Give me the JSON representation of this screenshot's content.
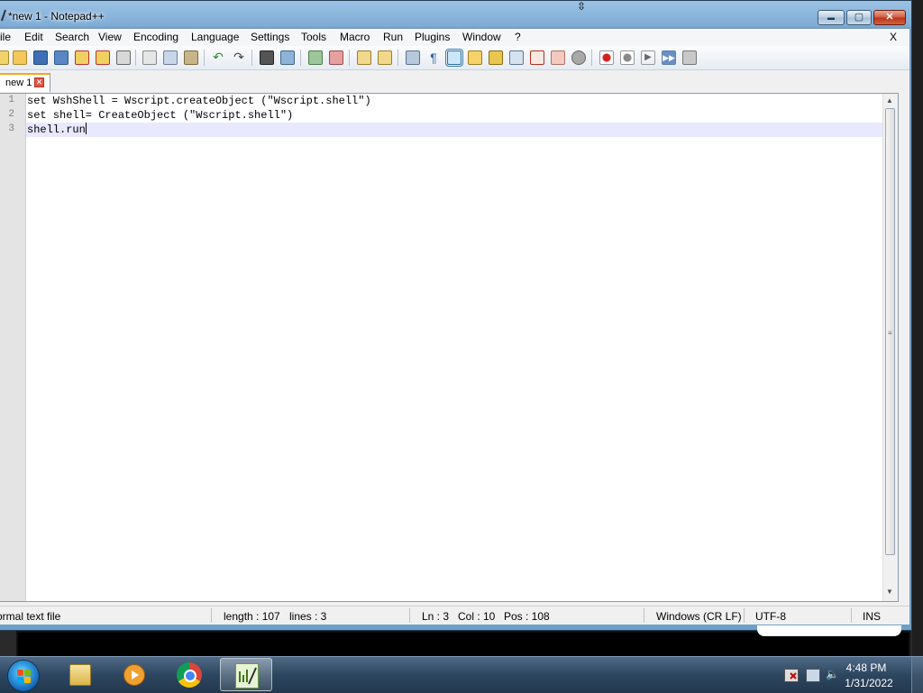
{
  "window": {
    "title": "*new 1 - Notepad++",
    "caption_buttons": {
      "minimize": "▬",
      "maximize": "▢",
      "close": "✕"
    }
  },
  "menu": {
    "items": [
      "ile",
      "Edit",
      "Search",
      "View",
      "Encoding",
      "Language",
      "Settings",
      "Tools",
      "Macro",
      "Run",
      "Plugins",
      "Window",
      "?"
    ],
    "close_document": "X"
  },
  "toolbar": {
    "icons": [
      "new-file-icon",
      "open-file-icon",
      "save-icon",
      "save-all-icon",
      "close-icon",
      "close-all-icon",
      "print-icon",
      "cut-icon",
      "copy-icon",
      "paste-icon",
      "undo-icon",
      "redo-icon",
      "find-icon",
      "replace-icon",
      "zoom-in-icon",
      "zoom-out-icon",
      "sync-vertical-icon",
      "sync-horizontal-icon",
      "word-wrap-icon",
      "show-all-characters-icon",
      "indent-guide-icon",
      "user-defined-language-icon",
      "document-map-icon",
      "function-list-icon",
      "folder-as-workspace-icon",
      "monitoring-icon",
      "record-macro-icon",
      "stop-recording-icon",
      "playback-macro-icon",
      "run-macro-multiple-icon",
      "save-macro-icon"
    ]
  },
  "tabs": [
    {
      "label": "new 1",
      "close": "✕"
    }
  ],
  "editor": {
    "line_numbers": [
      "1",
      "2",
      "3"
    ],
    "lines": [
      "set WshShell = Wscript.createObject (\"Wscript.shell\")",
      "set shell= CreateObject (\"Wscript.shell\")",
      "shell.run"
    ],
    "current_line_index": 2
  },
  "scrollbar": {
    "up": "▲",
    "down": "▼",
    "grip": "≡"
  },
  "statusbar": {
    "file_type": "ormal text file",
    "length": "length : 107",
    "lines": "lines : 3",
    "ln": "Ln : 3",
    "col": "Col : 10",
    "pos": "Pos : 108",
    "eol": "Windows (CR LF)",
    "encoding": "UTF-8",
    "mode": "INS"
  },
  "taskbar": {
    "pinned": [
      "windows-explorer-icon",
      "media-player-icon",
      "chrome-icon",
      "notepad-plus-plus-icon"
    ],
    "active_app": "notepad-plus-plus-icon",
    "clock_time": "4:48 PM",
    "clock_date": "1/31/2022"
  }
}
